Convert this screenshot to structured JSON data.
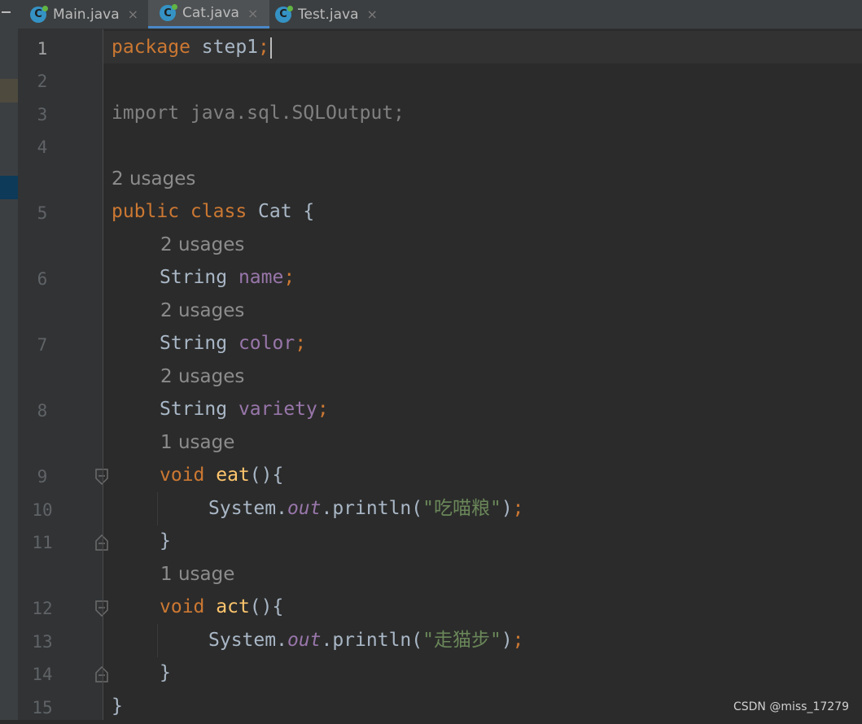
{
  "tabs": [
    {
      "label": "Main.java",
      "icon": "java-class-icon",
      "active": false
    },
    {
      "label": "Cat.java",
      "icon": "java-class-icon",
      "active": true
    },
    {
      "label": "Test.java",
      "icon": "java-class-icon",
      "active": false
    }
  ],
  "tab_icon_letter": "C",
  "tab_close": "×",
  "line_numbers": [
    "1",
    "2",
    "3",
    "4",
    "5",
    "6",
    "7",
    "8",
    "9",
    "10",
    "11",
    "12",
    "13",
    "14",
    "15"
  ],
  "code": {
    "l1_kw": "package",
    "l1_pkg": " step1",
    "l1_semi": ";",
    "l3_import": "import java.sql.SQLOutput;",
    "hint_class": "2 usages",
    "l5_kw": "public class",
    "l5_name": " Cat {",
    "hint_name": "2 usages",
    "l6_type": "String ",
    "l6_field": "name",
    "l6_semi": ";",
    "hint_color": "2 usages",
    "l7_type": "String ",
    "l7_field": "color",
    "l7_semi": ";",
    "hint_variety": "2 usages",
    "l8_type": "String ",
    "l8_field": "variety",
    "l8_semi": ";",
    "hint_eat": "1 usage",
    "l9_kw": "void ",
    "l9_fn": "eat",
    "l9_rest": "(){",
    "l10_sys": "System.",
    "l10_out": "out",
    "l10_call": ".println(",
    "l10_str": "\"吃喵粮\"",
    "l10_end": ")",
    "l10_semi": ";",
    "l11_brace": "}",
    "hint_act": "1 usage",
    "l12_kw": "void ",
    "l12_fn": "act",
    "l12_rest": "(){",
    "l13_sys": "System.",
    "l13_out": "out",
    "l13_call": ".println(",
    "l13_str": "\"走猫步\"",
    "l13_end": ")",
    "l13_semi": ";",
    "l14_brace": "}",
    "l15_brace": "}"
  },
  "watermark": "CSDN @miss_17279",
  "colors": {
    "keyword": "#cc7832",
    "field": "#9876aa",
    "string": "#6a8759",
    "method": "#ffc66d",
    "text": "#a9b7c6",
    "hint": "#8c8c8c",
    "active_tab_underline": "#4a88c7"
  }
}
